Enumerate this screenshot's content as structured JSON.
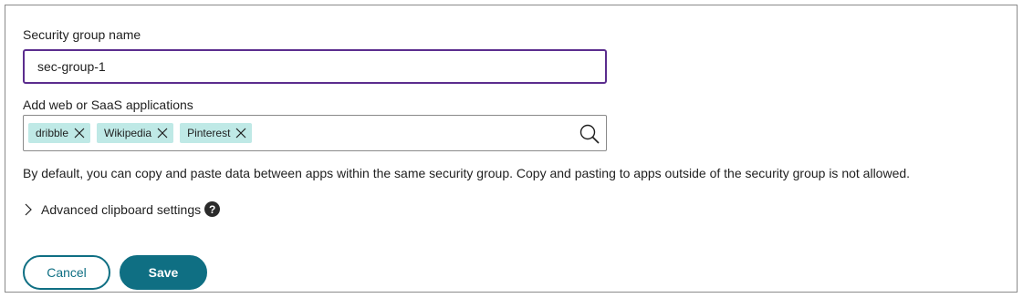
{
  "form": {
    "name_label": "Security group name",
    "name_value": "sec-group-1",
    "apps_label": "Add web or SaaS applications",
    "chips": [
      "dribble",
      "Wikipedia",
      "Pinterest"
    ],
    "description": "By default, you can copy and paste data between apps within the same security group. Copy and pasting to apps outside of the security group is not allowed.",
    "advanced_label": "Advanced clipboard settings",
    "help_icon": "?",
    "icons": {
      "chip_close": "close-icon",
      "search": "search-icon",
      "chevron": "chevron-right-icon",
      "help": "question-circle-icon"
    },
    "colors": {
      "input_focus_border": "#5b2d8e",
      "chip_bg": "#bfe9e6",
      "primary": "#0f6f83"
    }
  },
  "actions": {
    "cancel_label": "Cancel",
    "save_label": "Save"
  }
}
